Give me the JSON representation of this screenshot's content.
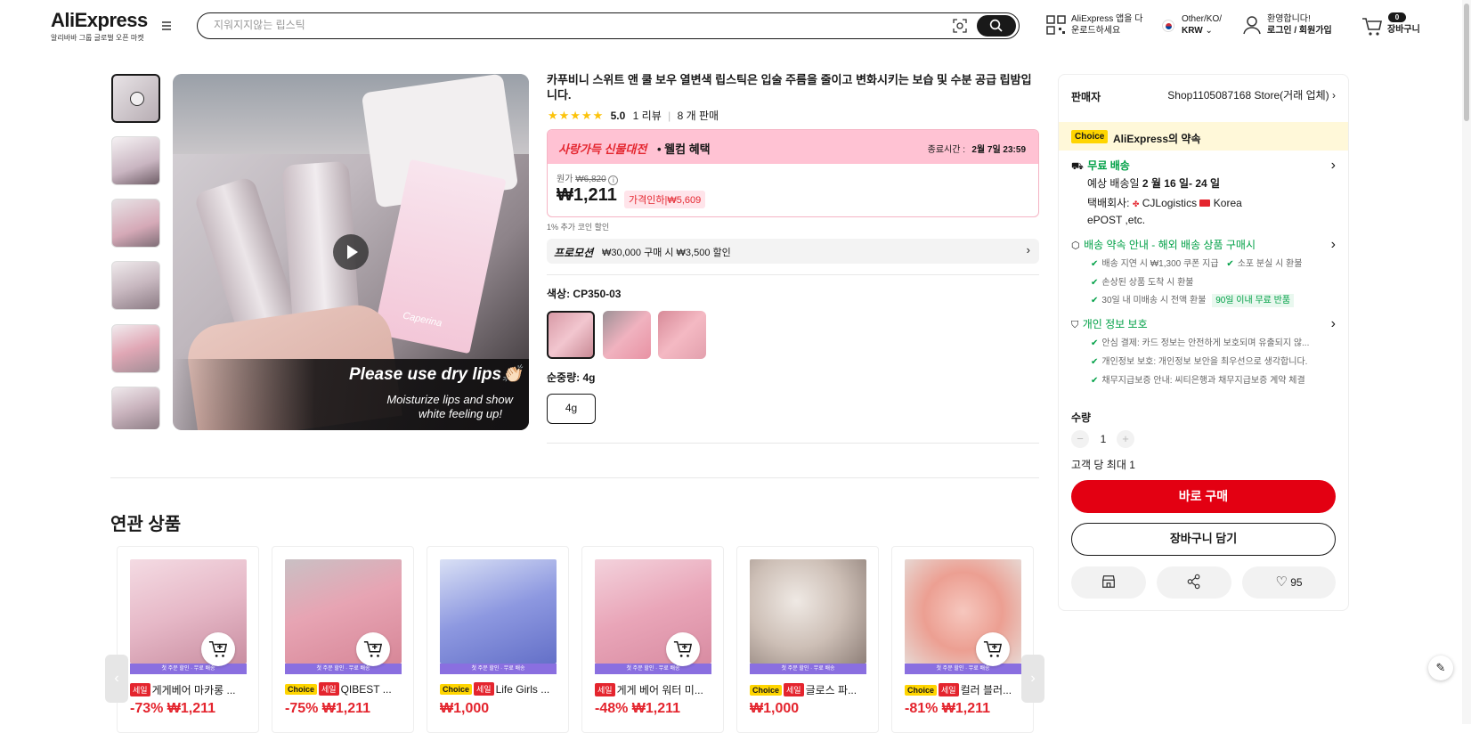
{
  "header": {
    "logo": "AliExpress",
    "logo_sub": "알리바바 그룹 글로벌 오픈 마켓",
    "search_placeholder": "지워지지않는 립스틱",
    "app_text_1": "AliExpress 앱을 다",
    "app_text_2": "운로드하세요",
    "region_line": "Other/KO/",
    "currency": "KRW",
    "welcome": "환영합니다!",
    "login": "로그인 / 회원가입",
    "cart_count": "0",
    "cart_label": "장바구니"
  },
  "gallery": {
    "overlay_text_1": "Please use dry lips👏🏻",
    "overlay_text_2": "Moisturize lips and show",
    "overlay_text_3": "white feeling up!",
    "box_brand": "Caperina"
  },
  "product": {
    "title": "카푸비니 스위트 앤 쿨 보우 열변색 립스틱은 입술 주름을 줄이고 변화시키는 보습 및 수분 공급 립밤입니다.",
    "rating": "5.0",
    "reviews": "1 리뷰",
    "sold": "8 개 판매",
    "promo_banner": "사랑가득 신물대전",
    "promo_banner_2": "• 웰컴 혜택",
    "ends_label": "종료시간 :",
    "ends_time": "2월 7일 23:59",
    "orig_price_label": "원가",
    "orig_price": "₩6,820",
    "price": "₩1,211",
    "discount_tag": "가격인하|₩5,609",
    "coin_note": "1% 추가 코인 할인",
    "promotion_label": "프로모션",
    "promotion_text": "₩30,000 구매 시 ₩3,500 할인",
    "color_label": "색상:",
    "color_value": "CP350-03",
    "weight_label": "순중량:",
    "weight_value": "4g",
    "size_option": "4g"
  },
  "seller": {
    "label": "판매자",
    "name": "Shop1105087168 Store(거래 업체)",
    "choice_badge": "Choice",
    "promise": "AliExpress의 약속",
    "free_ship": "무료 배송",
    "est_label": "예상 배송일",
    "est_date": "2 월 16 일- 24 일",
    "carrier_label": "택배회사:",
    "carrier_1": "CJLogistics",
    "carrier_2": "Korea",
    "carrier_3": "ePOST ,etc.",
    "delivery_promise": "배송 약속 안내 - 해외 배송 상품 구매시",
    "dp_1": "배송 지연 시 ₩1,300 쿠폰 지급",
    "dp_2": "소포 분실 시 환불",
    "dp_3": "손상된 상품 도착 시 환불",
    "dp_4": "30일 내 미배송 시 전액 환불",
    "dp_badge": "90일 이내 무료 반품",
    "privacy": "개인 정보 보호",
    "pv_1": "안심 결제: 카드 정보는 안전하게 보호되며 유출되지 않...",
    "pv_2": "개인정보 보호: 개인정보 보안을 최우선으로 생각합니다.",
    "pv_3": "채무지급보증 안내: 씨티은행과 채무지급보증 계약 체결",
    "qty_label": "수량",
    "qty_value": "1",
    "qty_max": "고객 당 최대 1",
    "buy_now": "바로 구매",
    "add_cart": "장바구니 담기",
    "wish_count": "95"
  },
  "related": {
    "title": "연관 상품",
    "strip": "첫 주문 할인 · 무료 배송",
    "items": [
      {
        "choice": "",
        "sale": "세일",
        "name": "게게베어 마카롱 ...",
        "price": "-73% ₩1,211"
      },
      {
        "choice": "Choice",
        "sale": "세일",
        "name": "QIBEST ...",
        "price": "-75% ₩1,211"
      },
      {
        "choice": "Choice",
        "sale": "세일",
        "name": "Life Girls ...",
        "price": "₩1,000"
      },
      {
        "choice": "",
        "sale": "세일",
        "name": "게게 베어 워터 미...",
        "price": "-48% ₩1,211"
      },
      {
        "choice": "Choice",
        "sale": "세일",
        "name": "글로스 파...",
        "price": "₩1,000"
      },
      {
        "choice": "Choice",
        "sale": "세일",
        "name": "컬러 블러...",
        "price": "-81% ₩1,211"
      }
    ]
  }
}
